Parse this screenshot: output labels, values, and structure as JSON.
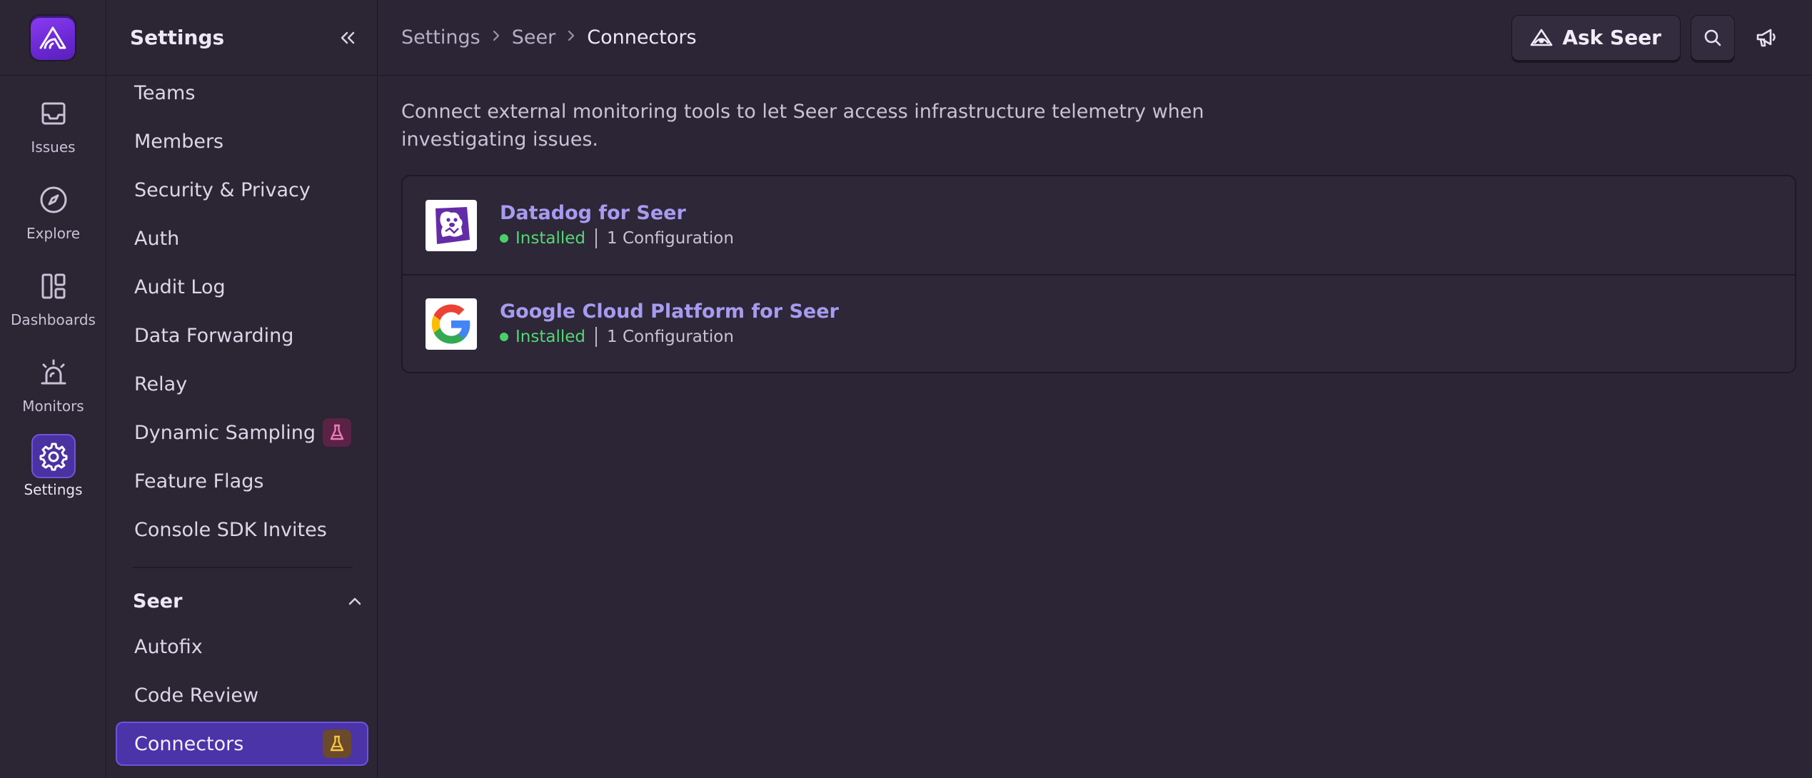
{
  "rail": {
    "items": [
      {
        "label": "Issues",
        "icon": "inbox-icon"
      },
      {
        "label": "Explore",
        "icon": "compass-icon"
      },
      {
        "label": "Dashboards",
        "icon": "dashboard-icon"
      },
      {
        "label": "Monitors",
        "icon": "siren-icon"
      },
      {
        "label": "Settings",
        "icon": "gear-icon",
        "active": true
      }
    ]
  },
  "sidebar": {
    "title": "Settings",
    "items": [
      {
        "label": "Teams"
      },
      {
        "label": "Members"
      },
      {
        "label": "Security & Privacy"
      },
      {
        "label": "Auth"
      },
      {
        "label": "Audit Log"
      },
      {
        "label": "Data Forwarding"
      },
      {
        "label": "Relay"
      },
      {
        "label": "Dynamic Sampling",
        "badge": "beta-flask-icon"
      },
      {
        "label": "Feature Flags"
      },
      {
        "label": "Console SDK Invites"
      }
    ],
    "section": {
      "title": "Seer",
      "items": [
        {
          "label": "Autofix"
        },
        {
          "label": "Code Review"
        },
        {
          "label": "Connectors",
          "badge": "beta-flask-icon",
          "active": true
        }
      ]
    }
  },
  "header": {
    "breadcrumb": [
      "Settings",
      "Seer",
      "Connectors"
    ],
    "ask_label": "Ask Seer"
  },
  "main": {
    "description": "Connect external monitoring tools to let Seer access infrastructure telemetry when investigating issues.",
    "connectors": [
      {
        "name": "Datadog for Seer",
        "status": "Installed",
        "config": "1 Configuration",
        "logo": "datadog-logo-icon"
      },
      {
        "name": "Google Cloud Platform for Seer",
        "status": "Installed",
        "config": "1 Configuration",
        "logo": "google-logo-icon"
      }
    ]
  },
  "colors": {
    "accent": "#4b33a8",
    "link": "#a79bf0",
    "installed": "#55d774",
    "background": "#2b2535"
  }
}
